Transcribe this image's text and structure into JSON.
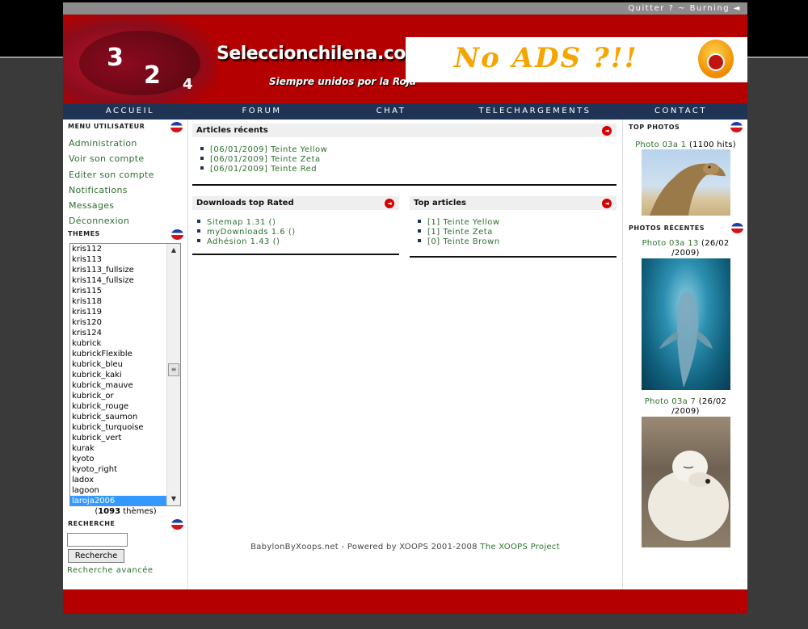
{
  "topbar": {
    "quit": "Quitter ?",
    "sep": "~",
    "user": "Burning",
    "arrow": "◄"
  },
  "header": {
    "site_title": "Seleccionchilena.com",
    "slogan": "Siempre unidos por la Roja",
    "jerseys": [
      "3",
      "2",
      "4"
    ],
    "banner_text": "No ADS ?!!"
  },
  "nav": {
    "items": [
      "ACCUEIL",
      "FORUM",
      "CHAT",
      "TELECHARGEMENTS",
      "CONTACT"
    ]
  },
  "left": {
    "menu_title": "MENU UTILISATEUR",
    "menu_items": [
      "Administration",
      "Voir son compte",
      "Editer son compte",
      "Notifications",
      "Messages",
      "Déconnexion"
    ],
    "themes_title": "THEMES",
    "themes": [
      "kris112",
      "kris113",
      "kris113_fullsize",
      "kris114_fullsize",
      "kris115",
      "kris118",
      "kris119",
      "kris120",
      "kris124",
      "kubrick",
      "kubrickFlexible",
      "kubrick_bleu",
      "kubrick_kaki",
      "kubrick_mauve",
      "kubrick_or",
      "kubrick_rouge",
      "kubrick_saumon",
      "kubrick_turquoise",
      "kubrick_vert",
      "kurak",
      "kyoto",
      "kyoto_right",
      "ladox",
      "lagoon",
      "laroja2006"
    ],
    "themes_selected": "laroja2006",
    "themes_count_open": "(",
    "themes_count_num": "1093",
    "themes_count_rest": " thèmes)",
    "search_title": "RECHERCHE",
    "search_value": "",
    "search_button": "Recherche",
    "advanced_search": "Recherche avancée"
  },
  "center": {
    "recent_title": "Articles récents",
    "recent_items": [
      {
        "date": "[06/01/2009]",
        "title": "Teinte Yellow"
      },
      {
        "date": "[06/01/2009]",
        "title": "Teinte Zeta"
      },
      {
        "date": "[06/01/2009]",
        "title": "Teinte Red"
      }
    ],
    "downloads_title": "Downloads top Rated",
    "downloads_items": [
      "Sitemap 1.31 ()",
      "myDownloads 1.6 ()",
      "Adhésion 1.43 ()"
    ],
    "top_title": "Top articles",
    "top_items": [
      {
        "count": "[1]",
        "title": "Teinte Yellow"
      },
      {
        "count": "[1]",
        "title": "Teinte Zeta"
      },
      {
        "count": "[0]",
        "title": "Teinte Brown"
      }
    ],
    "footer_prefix": "BabylonByXoops.net - Powered by XOOPS 2001-2008 ",
    "footer_link": "The XOOPS Project"
  },
  "right": {
    "top_photos_title": "TOP PHOTOS",
    "top_photo": {
      "name": "Photo 03a 1",
      "meta": " (1100 hits)"
    },
    "recent_photos_title": "PHOTOS RÉCENTES",
    "recent_photos": [
      {
        "name": "Photo 03a 13",
        "meta_1": " (26/02",
        "meta_2": "/2009)"
      },
      {
        "name": "Photo 03a 7",
        "meta_1": " (26/02",
        "meta_2": "/2009)"
      }
    ]
  },
  "colors": {
    "brand_red": "#b40000",
    "nav_blue": "#1f3455",
    "link_green": "#2e6f2e"
  }
}
